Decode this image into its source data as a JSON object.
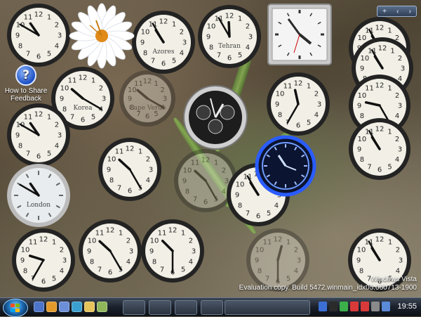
{
  "desktop": {
    "icon_help": {
      "label_line1": "How to Share",
      "label_line2": "Feedback",
      "glyph": "?"
    },
    "gadget_toolbar": {
      "add": "+",
      "prev": "‹",
      "next": "›"
    }
  },
  "clock_labels": {
    "azores": "Azores",
    "tehran": "Tehran",
    "korea": "Korea",
    "london": "London",
    "faded": "Cape Verde"
  },
  "numerals": [
    "12",
    "1",
    "2",
    "3",
    "4",
    "5",
    "6",
    "7",
    "8",
    "9",
    "10",
    "11"
  ],
  "watermark": {
    "line1": "Windows Vista",
    "line2": "Evaluation copy. Build 5472.winmain_idx05.060713-1900"
  },
  "taskbar": {
    "clock": "19:55"
  },
  "colors": {
    "clock_face": "#f2f0e6",
    "clock_rim": "#232323",
    "neon": "#2a5cff"
  }
}
